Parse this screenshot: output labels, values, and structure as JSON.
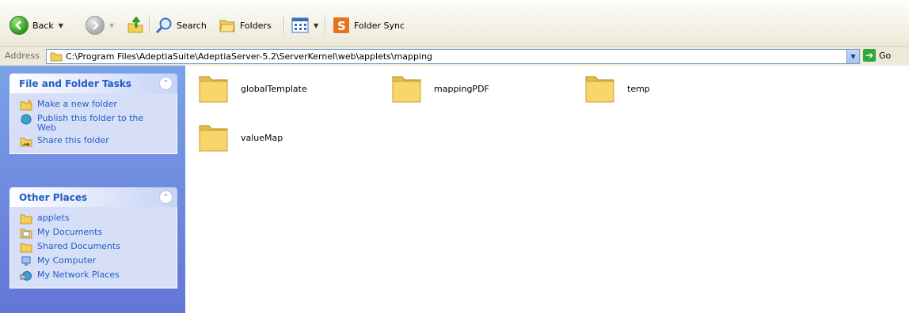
{
  "toolbar": {
    "back_label": "Back",
    "search_label": "Search",
    "folders_label": "Folders",
    "folder_sync_label": "Folder Sync"
  },
  "address": {
    "label": "Address",
    "path": "C:\\Program Files\\AdeptiaSuite\\AdeptiaServer-5.2\\ServerKernel\\web\\applets\\mapping",
    "go_label": "Go"
  },
  "sidebar": {
    "tasks_panel": {
      "title": "File and Folder Tasks",
      "items": [
        {
          "label": "Make a new folder",
          "icon": "new-folder-icon"
        },
        {
          "label": "Publish this folder to the Web",
          "icon": "publish-web-icon"
        },
        {
          "label": "Share this folder",
          "icon": "share-folder-icon"
        }
      ]
    },
    "places_panel": {
      "title": "Other Places",
      "items": [
        {
          "label": "applets",
          "icon": "folder-icon"
        },
        {
          "label": "My Documents",
          "icon": "my-documents-icon"
        },
        {
          "label": "Shared Documents",
          "icon": "folder-icon"
        },
        {
          "label": "My Computer",
          "icon": "my-computer-icon"
        },
        {
          "label": "My Network Places",
          "icon": "network-places-icon"
        }
      ]
    }
  },
  "content": {
    "folders": [
      {
        "name": "globalTemplate"
      },
      {
        "name": "mappingPDF"
      },
      {
        "name": "temp"
      },
      {
        "name": "valueMap"
      }
    ]
  },
  "colors": {
    "sidebar_top": "#7ba2e7",
    "sidebar_bottom": "#6375d6",
    "link_blue": "#215dc6",
    "folder_yellow": "#f8d66b"
  }
}
